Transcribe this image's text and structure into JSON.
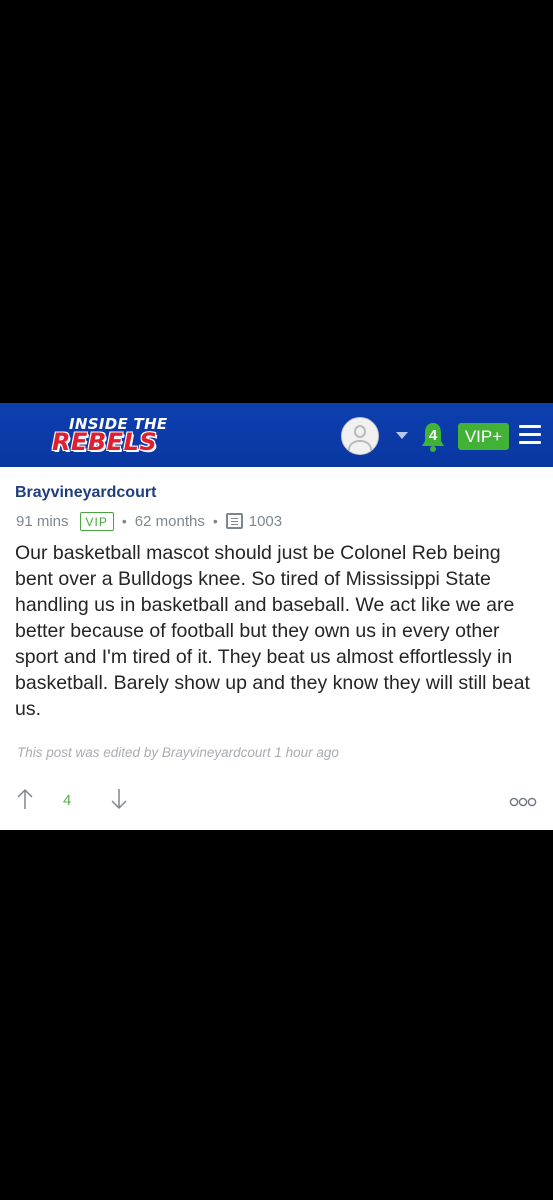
{
  "header": {
    "logo_line1": "INSIDE THE",
    "logo_line2": "REBELS",
    "notification_count": "4",
    "vip_plus_label": "VIP+",
    "colors": {
      "header_bg": "#0b3aa6",
      "logo_red": "#e21f2f",
      "green": "#42b236"
    }
  },
  "post": {
    "author": "Brayvineyardcourt",
    "time_ago": "91 mins",
    "badge": "VIP",
    "member_since": "62 months",
    "post_count": "1003",
    "body": "Our basketball mascot should just be Colonel Reb being bent over a Bulldogs knee. So tired of Mississippi State handling us in basketball and baseball. We act like we are better because of football but they own us in every other sport and I'm tired of it. They beat us almost effortlessly in basketball. Barely show up and they know they will still beat us.",
    "edited_note": "This post was edited by Brayvineyardcourt 1 hour ago",
    "vote_count": "4"
  },
  "icons": [
    "avatar",
    "chevron-down-icon",
    "bell-icon",
    "menu-icon",
    "comment-icon",
    "upvote-arrow-icon",
    "downvote-arrow-icon",
    "more-options-icon"
  ]
}
